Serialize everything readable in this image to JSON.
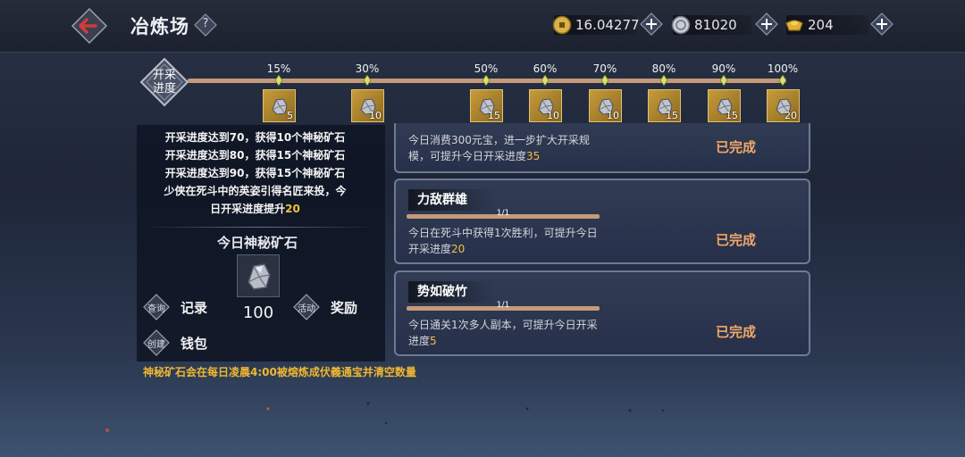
{
  "header": {
    "title": "冶炼场",
    "help_label": "?"
  },
  "resources": [
    {
      "name": "coin",
      "value": "16.04277"
    },
    {
      "name": "silver",
      "value": "81020"
    },
    {
      "name": "ingot",
      "value": "204"
    }
  ],
  "progress": {
    "label_line1": "开采",
    "label_line2": "进度",
    "fraction": 0.0,
    "milestones": [
      {
        "pct": "15%",
        "count": "5"
      },
      {
        "pct": "30%",
        "count": "10"
      },
      {
        "pct": "50%",
        "count": "15"
      },
      {
        "pct": "60%",
        "count": "10"
      },
      {
        "pct": "70%",
        "count": "10"
      },
      {
        "pct": "80%",
        "count": "15"
      },
      {
        "pct": "90%",
        "count": "15"
      },
      {
        "pct": "100%",
        "count": "20"
      }
    ]
  },
  "left_panel": {
    "desc_lines": [
      "开采进度达到70，获得10个神秘矿石",
      "开采进度达到80，获得15个神秘矿石",
      "开采进度达到90，获得15个神秘矿石",
      "少侠在死斗中的英姿引得名匠来投，今"
    ],
    "desc_last_prefix": "日开采进度提升",
    "desc_last_value": "20",
    "today_title": "今日神秘矿石",
    "ore_count": "100",
    "actions": {
      "record_badge": "查询",
      "record_label": "记录",
      "reward_badge": "活动",
      "reward_label": "奖励",
      "wallet_badge": "创建",
      "wallet_label": "钱包"
    },
    "notice": "神秘矿石会在每日凌晨4:00被熔炼成伏義通宝并清空数量"
  },
  "tasks": [
    {
      "name": "",
      "progress_text": "",
      "desc": "今日消费300元宝，进一步扩大开采规模，可提升今日开采进度",
      "value": "35",
      "status": "已完成"
    },
    {
      "name": "力敌群雄",
      "progress_text": "1/1",
      "desc": "今日在死斗中获得1次胜利，可提升今日开采进度",
      "value": "20",
      "status": "已完成"
    },
    {
      "name": "势如破竹",
      "progress_text": "1/1",
      "desc": "今日通关1次多人副本，可提升今日开采进度",
      "value": "5",
      "status": "已完成"
    }
  ],
  "colors": {
    "accent_gold": "#f0c040",
    "status_orange": "#f0a868",
    "track": "#c49a78",
    "back_arrow": "#d43a3a"
  }
}
